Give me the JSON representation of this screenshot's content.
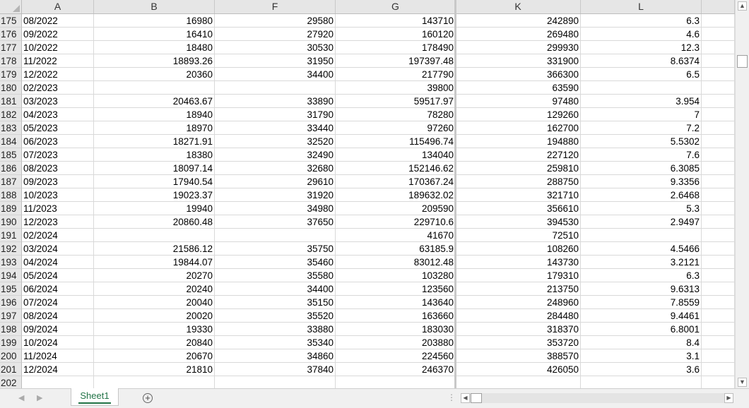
{
  "columns": [
    "A",
    "B",
    "F",
    "G",
    "K",
    "L"
  ],
  "rows": [
    {
      "n": "175",
      "A": "08/2022",
      "B": "16980",
      "F": "29580",
      "G": "143710",
      "K": "242890",
      "L": "6.3"
    },
    {
      "n": "176",
      "A": "09/2022",
      "B": "16410",
      "F": "27920",
      "G": "160120",
      "K": "269480",
      "L": "4.6"
    },
    {
      "n": "177",
      "A": "10/2022",
      "B": "18480",
      "F": "30530",
      "G": "178490",
      "K": "299930",
      "L": "12.3"
    },
    {
      "n": "178",
      "A": "11/2022",
      "B": "18893.26",
      "F": "31950",
      "G": "197397.48",
      "K": "331900",
      "L": "8.6374"
    },
    {
      "n": "179",
      "A": "12/2022",
      "B": "20360",
      "F": "34400",
      "G": "217790",
      "K": "366300",
      "L": "6.5"
    },
    {
      "n": "180",
      "A": "02/2023",
      "B": "",
      "F": "",
      "G": "39800",
      "K": "63590",
      "L": ""
    },
    {
      "n": "181",
      "A": "03/2023",
      "B": "20463.67",
      "F": "33890",
      "G": "59517.97",
      "K": "97480",
      "L": "3.954"
    },
    {
      "n": "182",
      "A": "04/2023",
      "B": "18940",
      "F": "31790",
      "G": "78280",
      "K": "129260",
      "L": "7"
    },
    {
      "n": "183",
      "A": "05/2023",
      "B": "18970",
      "F": "33440",
      "G": "97260",
      "K": "162700",
      "L": "7.2"
    },
    {
      "n": "184",
      "A": "06/2023",
      "B": "18271.91",
      "F": "32520",
      "G": "115496.74",
      "K": "194880",
      "L": "5.5302"
    },
    {
      "n": "185",
      "A": "07/2023",
      "B": "18380",
      "F": "32490",
      "G": "134040",
      "K": "227120",
      "L": "7.6"
    },
    {
      "n": "186",
      "A": "08/2023",
      "B": "18097.14",
      "F": "32680",
      "G": "152146.62",
      "K": "259810",
      "L": "6.3085"
    },
    {
      "n": "187",
      "A": "09/2023",
      "B": "17940.54",
      "F": "29610",
      "G": "170367.24",
      "K": "288750",
      "L": "9.3356"
    },
    {
      "n": "188",
      "A": "10/2023",
      "B": "19023.37",
      "F": "31920",
      "G": "189632.02",
      "K": "321710",
      "L": "2.6468"
    },
    {
      "n": "189",
      "A": "11/2023",
      "B": "19940",
      "F": "34980",
      "G": "209590",
      "K": "356610",
      "L": "5.3"
    },
    {
      "n": "190",
      "A": "12/2023",
      "B": "20860.48",
      "F": "37650",
      "G": "229710.6",
      "K": "394530",
      "L": "2.9497"
    },
    {
      "n": "191",
      "A": "02/2024",
      "B": "",
      "F": "",
      "G": "41670",
      "K": "72510",
      "L": ""
    },
    {
      "n": "192",
      "A": "03/2024",
      "B": "21586.12",
      "F": "35750",
      "G": "63185.9",
      "K": "108260",
      "L": "4.5466"
    },
    {
      "n": "193",
      "A": "04/2024",
      "B": "19844.07",
      "F": "35460",
      "G": "83012.48",
      "K": "143730",
      "L": "3.2121"
    },
    {
      "n": "194",
      "A": "05/2024",
      "B": "20270",
      "F": "35580",
      "G": "103280",
      "K": "179310",
      "L": "6.3"
    },
    {
      "n": "195",
      "A": "06/2024",
      "B": "20240",
      "F": "34400",
      "G": "123560",
      "K": "213750",
      "L": "9.6313"
    },
    {
      "n": "196",
      "A": "07/2024",
      "B": "20040",
      "F": "35150",
      "G": "143640",
      "K": "248960",
      "L": "7.8559"
    },
    {
      "n": "197",
      "A": "08/2024",
      "B": "20020",
      "F": "35520",
      "G": "163660",
      "K": "284480",
      "L": "9.4461"
    },
    {
      "n": "198",
      "A": "09/2024",
      "B": "19330",
      "F": "33880",
      "G": "183030",
      "K": "318370",
      "L": "6.8001"
    },
    {
      "n": "199",
      "A": "10/2024",
      "B": "20840",
      "F": "35340",
      "G": "203880",
      "K": "353720",
      "L": "8.4"
    },
    {
      "n": "200",
      "A": "11/2024",
      "B": "20670",
      "F": "34860",
      "G": "224560",
      "K": "388570",
      "L": "3.1"
    },
    {
      "n": "201",
      "A": "12/2024",
      "B": "21810",
      "F": "37840",
      "G": "246370",
      "K": "426050",
      "L": "3.6"
    },
    {
      "n": "202",
      "A": "",
      "B": "",
      "F": "",
      "G": "",
      "K": "",
      "L": ""
    }
  ],
  "tabs": {
    "sheet1": "Sheet1",
    "add_icon": "plus-circle-icon"
  },
  "colors": {
    "accent": "#217346",
    "header_bg": "#e6e6e6",
    "gridline": "#d9d9d9"
  }
}
